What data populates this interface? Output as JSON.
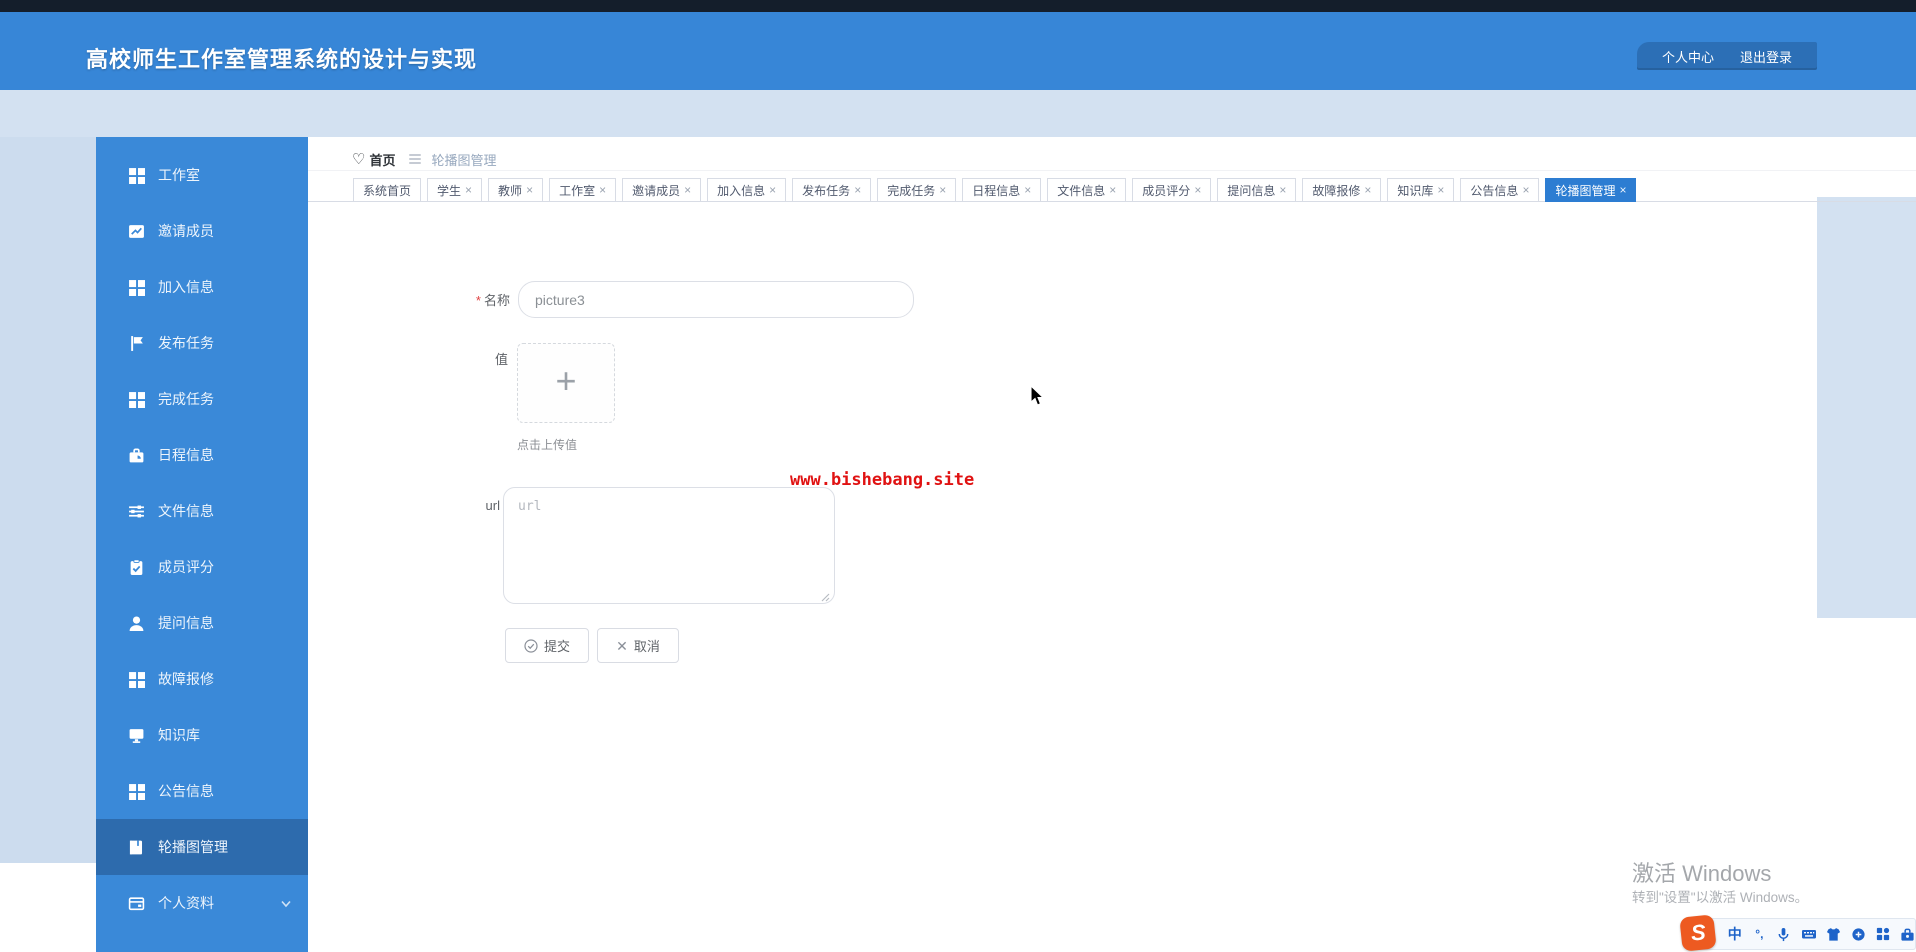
{
  "colors": {
    "header_blue": "#3786d7",
    "header_dark_strip": "#141e2b",
    "user_box_blue": "#2c6fb6",
    "sidebar_blue": "#3a89d8",
    "sidebar_active_blue": "#2d6bad",
    "page_light_blue": "#d3e1f1",
    "active_tab_blue": "#2d7dd2",
    "watermark_red": "#e01212",
    "required_red": "#e04343"
  },
  "header": {
    "title": "高校师生工作室管理系统的设计与实现",
    "user_menu": {
      "profile": "个人中心",
      "logout": "退出登录"
    }
  },
  "sidebar": {
    "items": [
      {
        "name": "studio",
        "label": "工作室",
        "icon": "grid",
        "active": false
      },
      {
        "name": "invite-members",
        "label": "邀请成员",
        "icon": "trend",
        "active": false
      },
      {
        "name": "join-info",
        "label": "加入信息",
        "icon": "grid",
        "active": false
      },
      {
        "name": "publish-task",
        "label": "发布任务",
        "icon": "flag",
        "active": false
      },
      {
        "name": "complete-task",
        "label": "完成任务",
        "icon": "grid",
        "active": false
      },
      {
        "name": "schedule-info",
        "label": "日程信息",
        "icon": "briefcase",
        "active": false
      },
      {
        "name": "file-info",
        "label": "文件信息",
        "icon": "sliders",
        "active": false
      },
      {
        "name": "member-score",
        "label": "成员评分",
        "icon": "clipboard",
        "active": false
      },
      {
        "name": "question-info",
        "label": "提问信息",
        "icon": "user",
        "active": false
      },
      {
        "name": "fault-repair",
        "label": "故障报修",
        "icon": "grid",
        "active": false
      },
      {
        "name": "knowledge-base",
        "label": "知识库",
        "icon": "monitor",
        "active": false
      },
      {
        "name": "announcement-info",
        "label": "公告信息",
        "icon": "grid",
        "active": false
      },
      {
        "name": "carousel-management",
        "label": "轮播图管理",
        "icon": "notebook",
        "active": true
      },
      {
        "name": "personal-profile",
        "label": "个人资料",
        "icon": "idcard",
        "active": false,
        "chevron": true
      }
    ]
  },
  "breadcrumb": {
    "home": "首页",
    "current": "轮播图管理"
  },
  "tabs": [
    {
      "name": "home",
      "label": "系统首页",
      "closable": false,
      "active": false
    },
    {
      "name": "student",
      "label": "学生",
      "closable": true,
      "active": false
    },
    {
      "name": "teacher",
      "label": "教师",
      "closable": true,
      "active": false
    },
    {
      "name": "studio",
      "label": "工作室",
      "closable": true,
      "active": false
    },
    {
      "name": "invite-members",
      "label": "邀请成员",
      "closable": true,
      "active": false
    },
    {
      "name": "join-info",
      "label": "加入信息",
      "closable": true,
      "active": false
    },
    {
      "name": "publish-task",
      "label": "发布任务",
      "closable": true,
      "active": false
    },
    {
      "name": "complete-task",
      "label": "完成任务",
      "closable": true,
      "active": false
    },
    {
      "name": "schedule-info",
      "label": "日程信息",
      "closable": true,
      "active": false
    },
    {
      "name": "file-info",
      "label": "文件信息",
      "closable": true,
      "active": false
    },
    {
      "name": "member-score",
      "label": "成员评分",
      "closable": true,
      "active": false
    },
    {
      "name": "question-info",
      "label": "提问信息",
      "closable": true,
      "active": false
    },
    {
      "name": "fault-repair",
      "label": "故障报修",
      "closable": true,
      "active": false
    },
    {
      "name": "knowledge-base",
      "label": "知识库",
      "closable": true,
      "active": false
    },
    {
      "name": "announcement-info",
      "label": "公告信息",
      "closable": true,
      "active": false
    },
    {
      "name": "carousel-management",
      "label": "轮播图管理",
      "closable": true,
      "active": true
    }
  ],
  "form": {
    "name_label": "名称",
    "name_value": "picture3",
    "value_label": "值",
    "upload_hint": "点击上传值",
    "url_label": "url",
    "url_placeholder": "url",
    "submit_label": "提交",
    "cancel_label": "取消",
    "watermark": "www.bishebang.site"
  },
  "windows_activation": {
    "line1": "激活 Windows",
    "line2": "转到\"设置\"以激活 Windows。"
  },
  "ime_toolbar": {
    "logo": "S",
    "icons": [
      "chinese-mode",
      "punctuation",
      "microphone",
      "keyboard",
      "skin",
      "emoji",
      "grid4",
      "toolbox"
    ],
    "chinese_mode_label": "中",
    "punctuation_label": "°,"
  }
}
